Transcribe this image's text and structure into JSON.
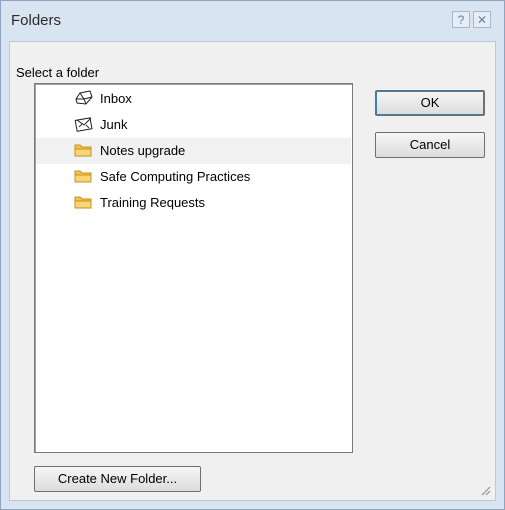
{
  "window": {
    "title": "Folders",
    "help_glyph": "?",
    "close_glyph": "✕"
  },
  "dialog": {
    "prompt": "Select a folder",
    "ok_label": "OK",
    "cancel_label": "Cancel",
    "create_label": "Create New Folder..."
  },
  "folders": [
    {
      "label": "Inbox",
      "icon": "inbox-icon",
      "selected": false
    },
    {
      "label": "Junk",
      "icon": "junk-icon",
      "selected": false
    },
    {
      "label": "Notes upgrade",
      "icon": "folder-icon",
      "selected": true
    },
    {
      "label": "Safe Computing Practices",
      "icon": "folder-icon",
      "selected": false
    },
    {
      "label": "Training Requests",
      "icon": "folder-icon",
      "selected": false
    }
  ],
  "colors": {
    "window_frame": "#d9e4f1",
    "client_bg": "#f0f0f0",
    "folder_yellow": "#f3c24a",
    "selection": "#f1f1f1"
  }
}
